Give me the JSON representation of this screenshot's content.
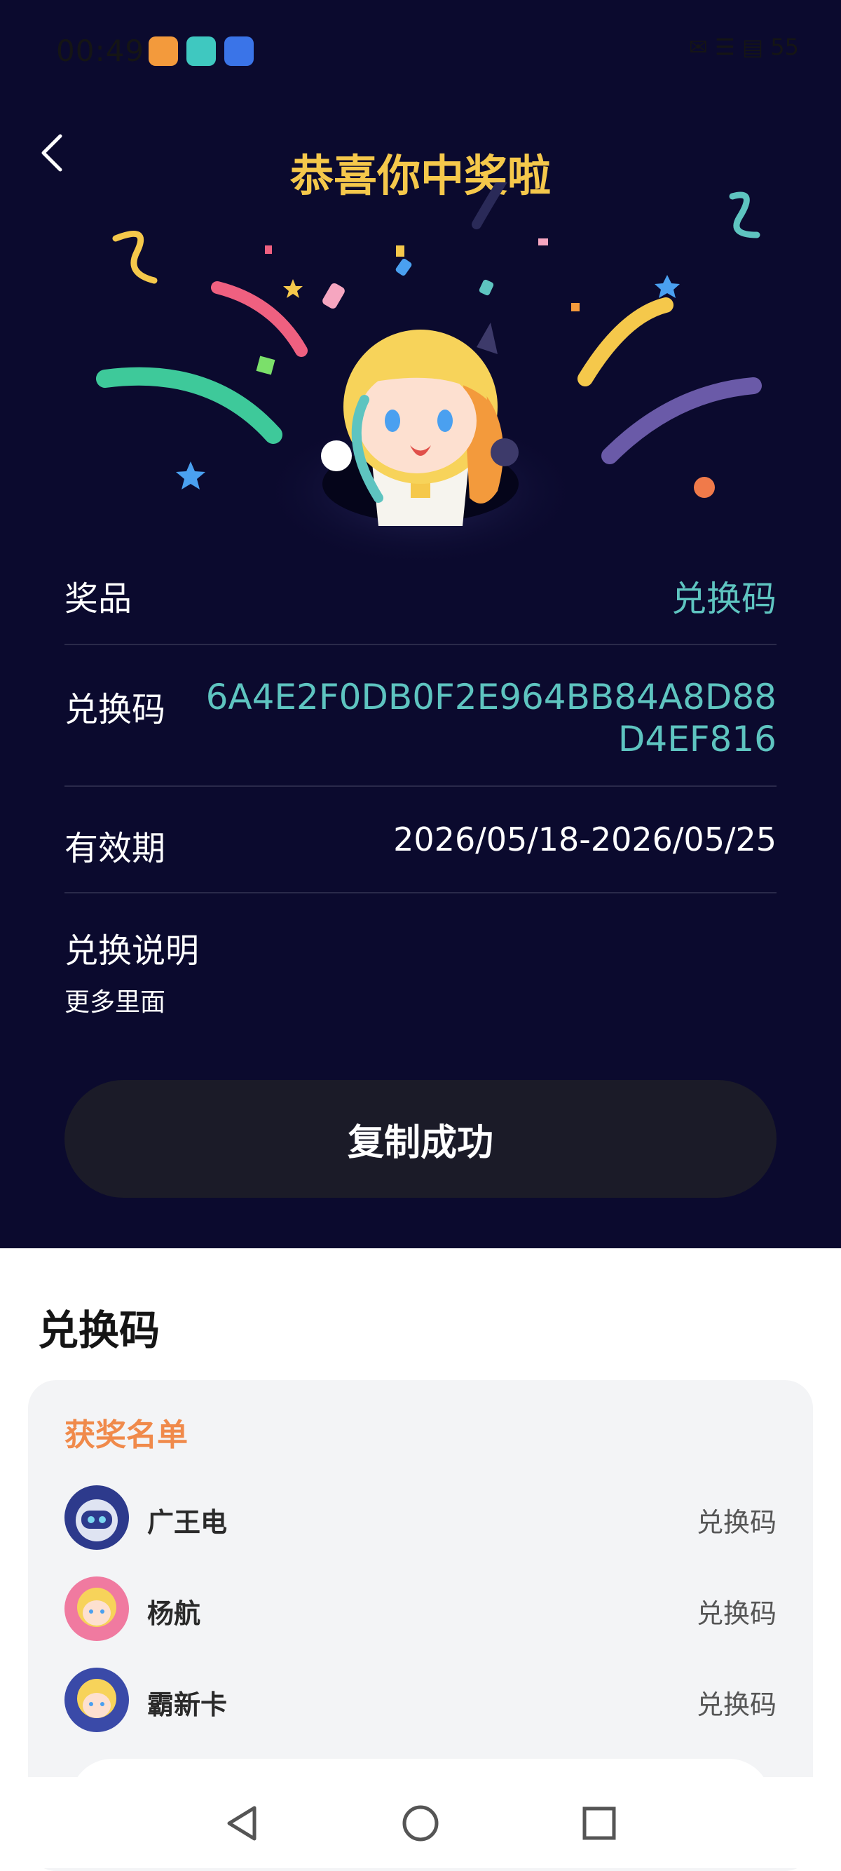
{
  "status_bar": {
    "time": "00:49",
    "right_text": "✉ ☰ ▤ 55"
  },
  "header": {
    "title": "恭喜你中奖啦"
  },
  "prize_info": {
    "prize_label": "奖品",
    "prize_value": "兑换码",
    "code_label": "兑换码",
    "code_value": "6A4E2F0DB0F2E964BB84A8D88D4EF816",
    "validity_label": "有效期",
    "validity_value": "2026/05/18-2026/05/25",
    "instructions_label": "兑换说明",
    "instructions_text": "更多里面"
  },
  "copy_button": {
    "label": "复制成功"
  },
  "sheet": {
    "title": "兑换码",
    "winners_title": "获奖名单",
    "winners": [
      {
        "name": "广王电",
        "prize": "兑换码"
      },
      {
        "name": "杨航",
        "prize": "兑换码"
      },
      {
        "name": "霸新卡",
        "prize": "兑换码"
      }
    ]
  },
  "colors": {
    "background": "#0b0a2e",
    "title": "#f5c84b",
    "accent": "#5ec4c0",
    "winners_title": "#f08a4b",
    "button": "#1b1b28"
  },
  "icons": {
    "back": "chevron-left-icon",
    "nav_back": "triangle-back-icon",
    "nav_home": "circle-home-icon",
    "nav_recent": "square-recent-icon"
  }
}
